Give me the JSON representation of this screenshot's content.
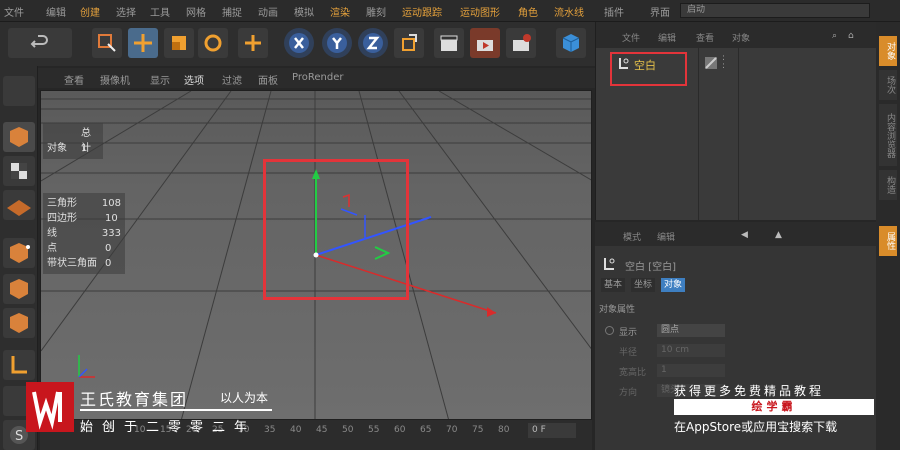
{
  "menu": {
    "items": [
      "文件",
      "编辑",
      "创建",
      "选择",
      "工具",
      "网格",
      "捕捉",
      "动画",
      "模拟",
      "渲染",
      "雕刻",
      "运动跟踪",
      "运动图形",
      "角色",
      "流水线",
      "插件",
      "脚本",
      "窗口",
      "帮助",
      "界面"
    ],
    "highlighted": [
      "渲染",
      "运动跟踪",
      "运动图形",
      "角色",
      "流水线"
    ],
    "layout_value": "启动"
  },
  "viewport_menu": {
    "items": [
      "查看",
      "摄像机",
      "显示",
      "选项",
      "过滤",
      "面板",
      "ProRender"
    ],
    "active": "选项"
  },
  "stats": {
    "total_header": "总计",
    "objects_label": "对象",
    "objects_value": "1",
    "triangles_label": "三角形",
    "triangles_value": "108",
    "quads_label": "四边形",
    "quads_value": "10",
    "lines_label": "线",
    "lines_value": "333",
    "points_label": "点",
    "points_value": "0",
    "strips_label": "带状三角面",
    "strips_value": "0"
  },
  "timeline": {
    "ticks": [
      "0",
      "5",
      "10",
      "15",
      "20",
      "25",
      "30",
      "35",
      "40",
      "45",
      "50",
      "55",
      "60",
      "65",
      "70",
      "75",
      "80",
      "85",
      "90"
    ],
    "frame_value": "0 F"
  },
  "object_manager": {
    "menu": [
      "文件",
      "编辑",
      "查看",
      "对象",
      "标签",
      "书签"
    ],
    "null_name": "空白"
  },
  "attribute_manager": {
    "menu": [
      "模式",
      "编辑",
      "用户数据"
    ],
    "title": "空白 [空白]",
    "tabs": [
      "基本",
      "坐标",
      "对象"
    ],
    "active_tab": "对象",
    "section": "对象属性",
    "display_label": "显示",
    "display_value": "圆点",
    "radius_label": "半径",
    "radius_value": "10 cm",
    "aspect_label": "宽高比",
    "aspect_value": "1",
    "orient_label": "方向",
    "orient_value": "镜头"
  },
  "right_tabs": [
    "对象",
    "场次",
    "内容浏览器",
    "构造",
    "层",
    "属性"
  ],
  "overlay": {
    "org_name": "王氏教育集团",
    "slogan": "以人为本",
    "sub": "始创于二零零二年",
    "promo_line1": "获得更多免费精品教程",
    "promo_app": "绘学霸",
    "promo_line3": "在AppStore或应用宝搜索下载"
  },
  "colors": {
    "accent_yellow": "#e6a23c",
    "annotation_red": "#e3343a",
    "active_blue": "#3e7fc1",
    "logo_red": "#c8161d"
  }
}
